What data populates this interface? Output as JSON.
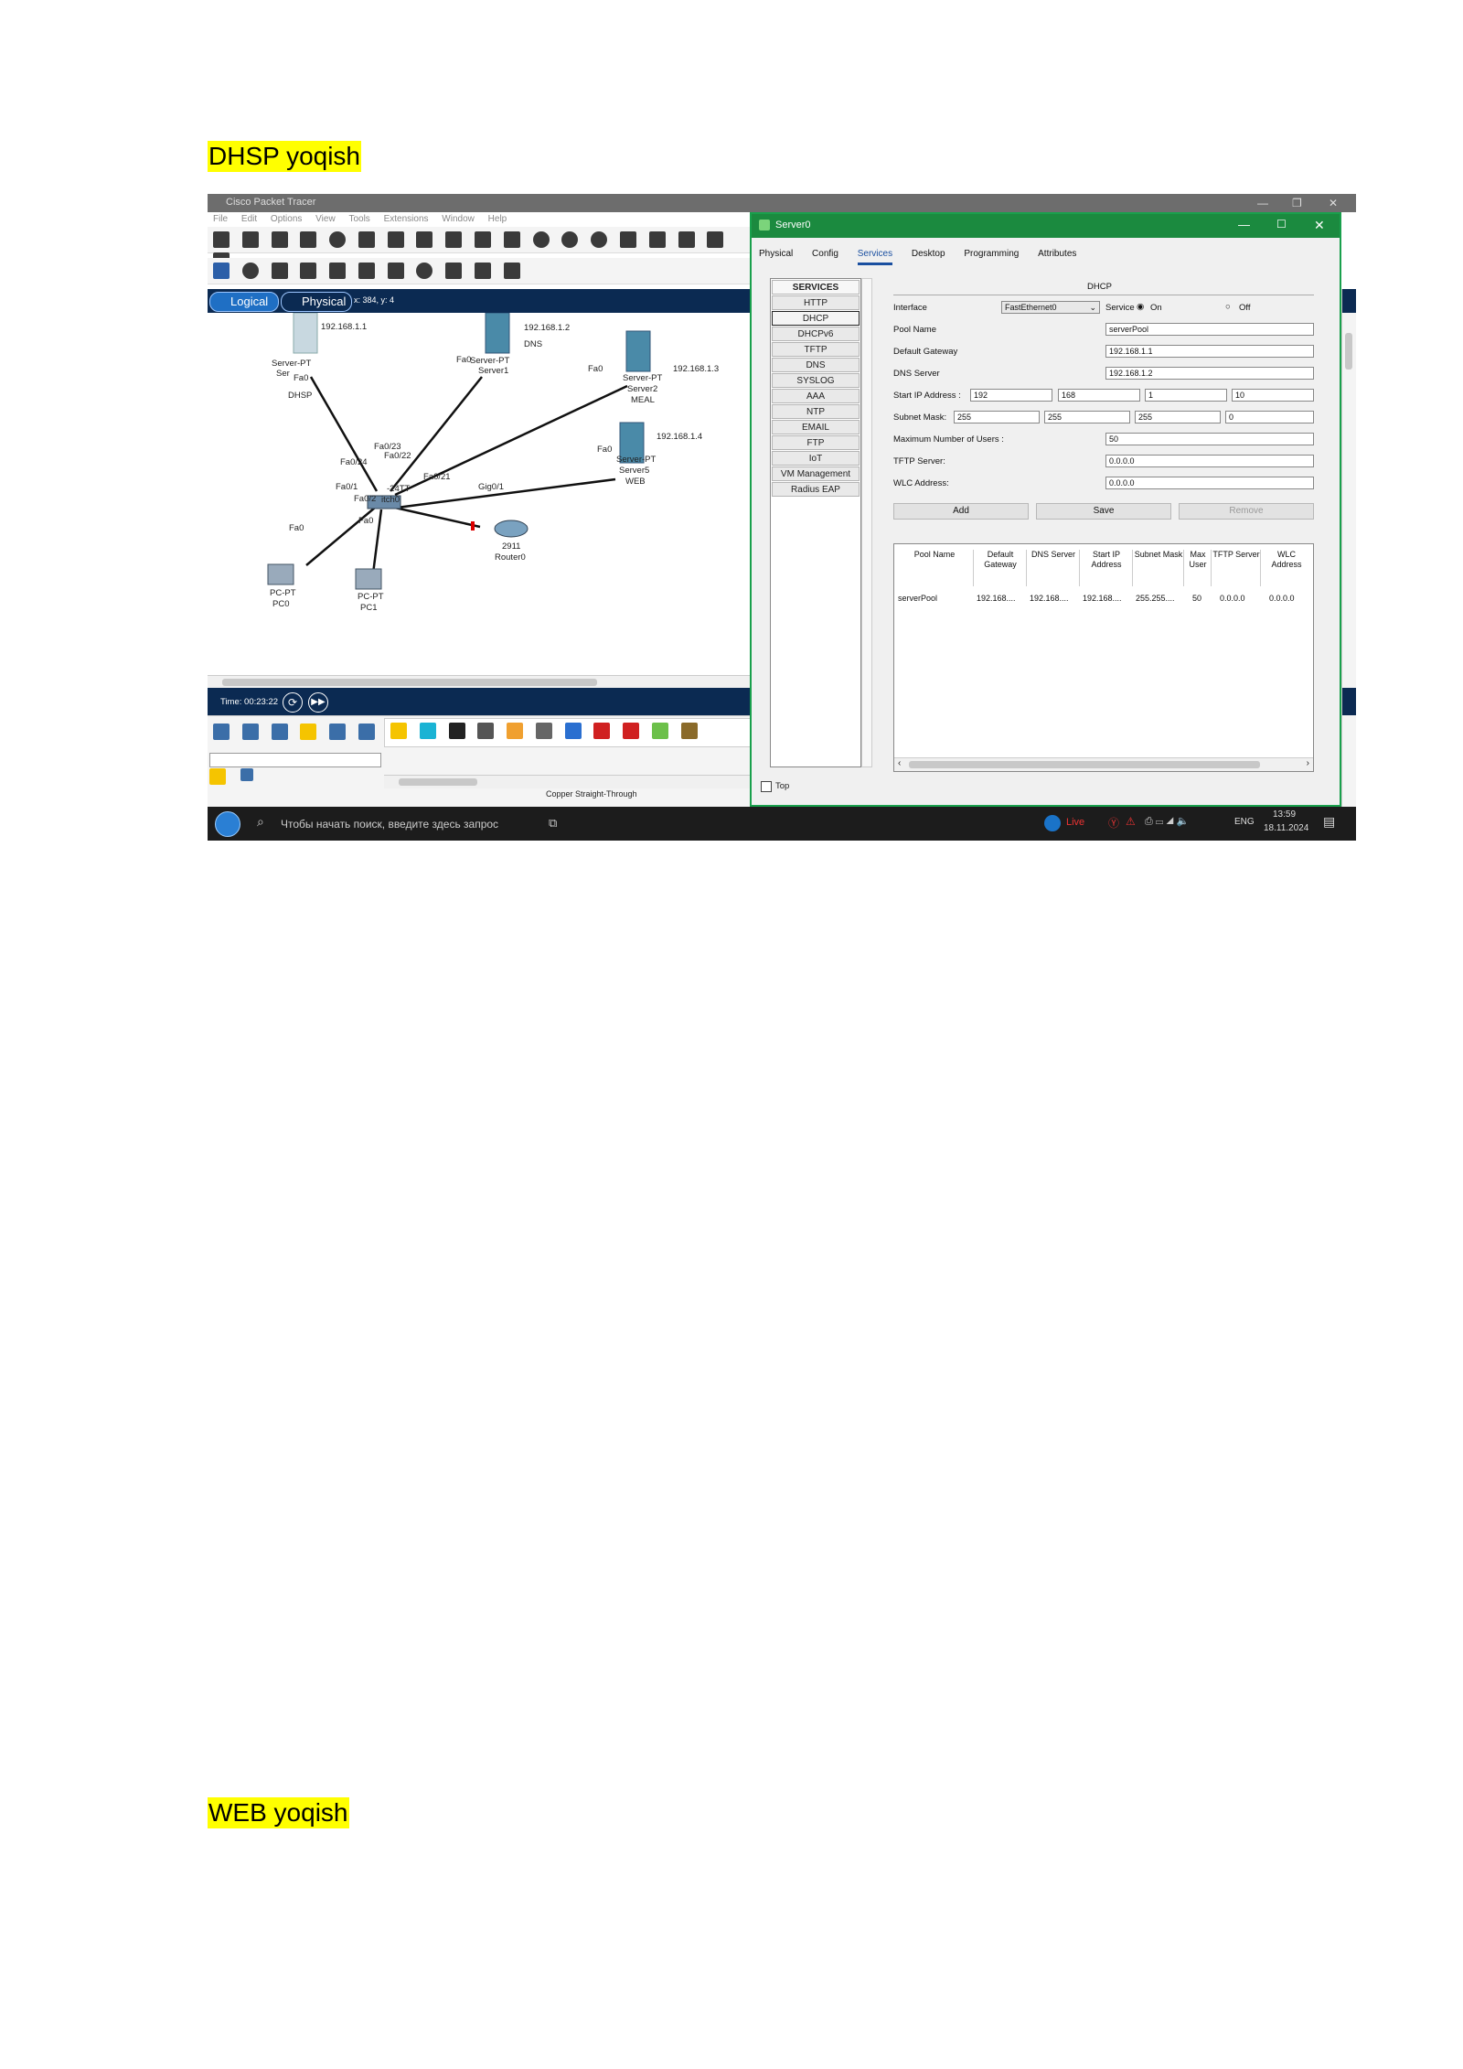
{
  "doc": {
    "heading1": "DHSP yoqish",
    "heading2": "WEB yoqish"
  },
  "screenshot": {
    "app_title": "Cisco Packet Tracer",
    "menu": [
      "File",
      "Edit",
      "Options",
      "View",
      "Tools",
      "Extensions",
      "Window",
      "Help"
    ],
    "mode_logical": "Logical",
    "mode_physical": "Physical",
    "coords": "x: 384, y: 4",
    "time": "Time: 00:23:22",
    "cable_label": "Copper Straight-Through",
    "topology": {
      "dhsp_ip": "192.168.1.1",
      "dhsp_type": "Server-PT",
      "dhsp_short": "Ser",
      "dhsp_port": "Fa0",
      "dhsp_name": "DHSP",
      "dns_ip": "192.168.1.2",
      "dns_name": "DNS",
      "dns_port": "Fa0",
      "dns_type": "Server-PT",
      "dns_id": "Server1",
      "meal_port": "Fa0",
      "meal_type": "Server-PT",
      "meal_id": "Server2",
      "meal_name": "MEAL",
      "meal_ip": "192.168.1.3",
      "web_ip": "192.168.1.4",
      "web_port": "Fa0",
      "web_type": "Server-PT",
      "web_id": "Server5",
      "web_name": "WEB",
      "sw_p23": "Fa0/23",
      "sw_p22": "Fa0/22",
      "sw_p24": "Fa0/24",
      "sw_p21": "Fa0/21",
      "sw_p1": "Fa0/1",
      "sw_p2": "Fa0/2",
      "sw_model": "-24TT",
      "sw_name": "itch0",
      "r_port": "Gig0/1",
      "r_model": "2911",
      "r_name": "Router0",
      "pc0_port": "Fa0",
      "pc0_type": "PC-PT",
      "pc0_name": "PC0",
      "pc1_port": "Fa0",
      "pc1_type": "PC-PT",
      "pc1_name": "PC1"
    },
    "taskbar": {
      "search": "Чтобы начать поиск, введите здесь запрос",
      "live": "Live",
      "lang": "ENG",
      "clock": "13:59",
      "date": "18.11.2024"
    }
  },
  "dialog": {
    "title": "Server0",
    "tabs": [
      "Physical",
      "Config",
      "Services",
      "Desktop",
      "Programming",
      "Attributes"
    ],
    "active_tab": "Services",
    "services": [
      "SERVICES",
      "HTTP",
      "DHCP",
      "DHCPv6",
      "TFTP",
      "DNS",
      "SYSLOG",
      "AAA",
      "NTP",
      "EMAIL",
      "FTP",
      "IoT",
      "VM Management",
      "Radius EAP"
    ],
    "selected_service": "DHCP",
    "section_title": "DHCP",
    "interface_label": "Interface",
    "interface_value": "FastEthernet0",
    "service_label": "Service",
    "service_on": "On",
    "service_off": "Off",
    "pool_name_label": "Pool Name",
    "pool_name": "serverPool",
    "gateway_label": "Default Gateway",
    "gateway": "192.168.1.1",
    "dns_label": "DNS Server",
    "dns": "192.168.1.2",
    "start_ip_label": "Start IP Address :",
    "start_ip": [
      "192",
      "168",
      "1",
      "10"
    ],
    "mask_label": "Subnet Mask:",
    "mask": [
      "255",
      "255",
      "255",
      "0"
    ],
    "max_users_label": "Maximum Number of Users :",
    "max_users": "50",
    "tftp_label": "TFTP Server:",
    "tftp": "0.0.0.0",
    "wlc_label": "WLC Address:",
    "wlc": "0.0.0.0",
    "btn_add": "Add",
    "btn_save": "Save",
    "btn_remove": "Remove",
    "table_headers": [
      "Pool Name",
      "Default Gateway",
      "DNS Server",
      "Start IP Address",
      "Subnet Mask",
      "Max User",
      "TFTP Server",
      "WLC Address"
    ],
    "table_row": [
      "serverPool",
      "192.168....",
      "192.168....",
      "192.168....",
      "255.255....",
      "50",
      "0.0.0.0",
      "0.0.0.0"
    ],
    "top_label": "Top"
  }
}
